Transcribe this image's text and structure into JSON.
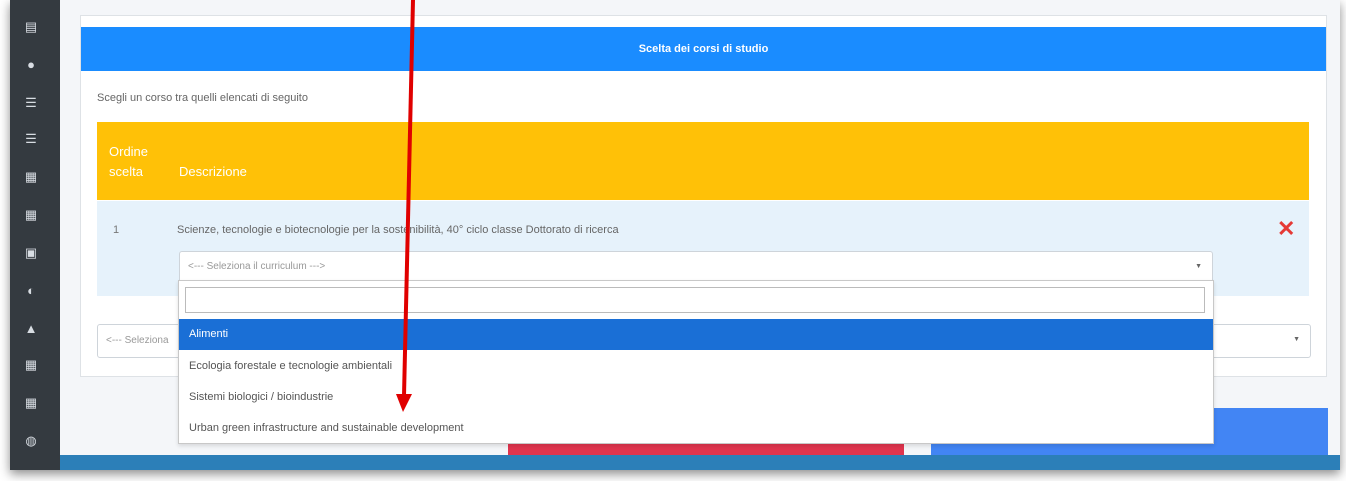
{
  "card": {
    "title": "Scelta dei corsi di studio",
    "intro": "Scegli un corso tra quelli elencati di seguito"
  },
  "table": {
    "headers": {
      "order": "Ordine scelta",
      "description": "Descrizione"
    },
    "rows": [
      {
        "order": "1",
        "description": "Scienze, tecnologie e biotecnologie per la sostenibilità, 40° ciclo classe Dottorato di ricerca"
      }
    ]
  },
  "curriculum_select": {
    "placeholder": "<--- Seleziona il curriculum --->"
  },
  "course_select": {
    "placeholder": "<--- Seleziona"
  },
  "dropdown": {
    "search_value": "",
    "options": [
      "Alimenti",
      "Ecologia forestale e tecnologie ambientali",
      "Sistemi biologici / bioindustrie",
      "Urban green infrastructure and sustainable development"
    ],
    "active_index": 0
  },
  "colors": {
    "header_blue": "#1a8cff",
    "table_header_yellow": "#ffc107",
    "row_light_blue": "#e6f2fb",
    "remove_red": "#e53935",
    "option_active": "#1a6fd6",
    "annotation_arrow": "#e00000"
  },
  "icons": {
    "sidebar": [
      "dashboard-icon",
      "user-add-icon",
      "list-icon",
      "ordered-list-icon",
      "document-icon",
      "calendar-icon",
      "card-icon",
      "user-settings-icon",
      "bell-icon",
      "grid-icon",
      "grid-icon",
      "globe-icon"
    ],
    "remove": "close-icon"
  }
}
